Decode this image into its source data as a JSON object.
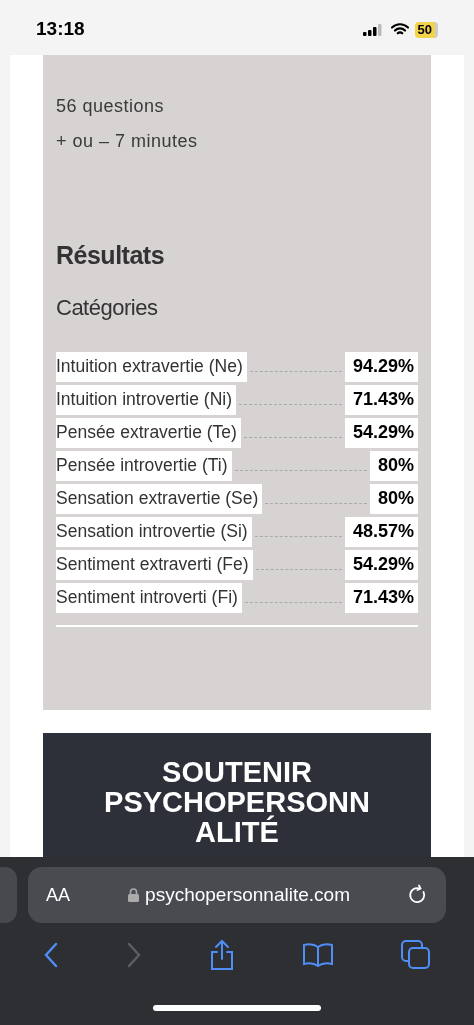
{
  "status_bar": {
    "time": "13:18",
    "battery": "50"
  },
  "intro": [
    "56 questions",
    "+ ou – 7 minutes"
  ],
  "results_title": "Résultats",
  "categories_title": "Catégories",
  "categories": [
    {
      "label": "Intuition extravertie (Ne)",
      "value": "94.29%"
    },
    {
      "label": "Intuition introvertie (Ni)",
      "value": "71.43%"
    },
    {
      "label": "Pensée extravertie (Te)",
      "value": "54.29%"
    },
    {
      "label": "Pensée introvertie (Ti)",
      "value": "80%"
    },
    {
      "label": "Sensation extravertie (Se)",
      "value": "80%"
    },
    {
      "label": "Sensation introvertie (Si)",
      "value": "48.57%"
    },
    {
      "label": "Sentiment extraverti (Fe)",
      "value": "54.29%"
    },
    {
      "label": "Sentiment introverti (Fi)",
      "value": "71.43%"
    }
  ],
  "support_banner": {
    "title": "SOUTENIR PSYCHOPERSONNALITÉ"
  },
  "browser": {
    "text_size_button": "AA",
    "url": "psychopersonnalite.com"
  }
}
